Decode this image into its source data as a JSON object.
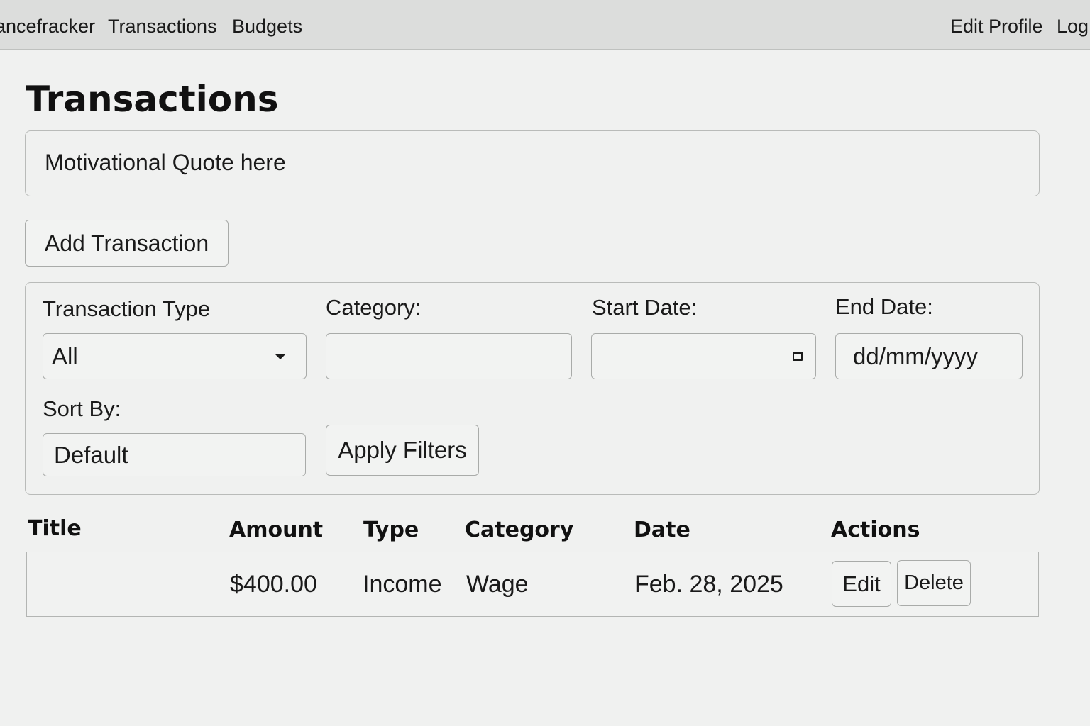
{
  "navbar": {
    "brand": "ancefracker",
    "transactions": "Transactions",
    "budgets": "Budgets",
    "edit_profile": "Edit Profile",
    "logout": "Log"
  },
  "page": {
    "title": "Transactions",
    "quote": "Motivational Quote here",
    "add_button": "Add Transaction"
  },
  "filters": {
    "type_label": "Transaction Type",
    "type_value": "All",
    "category_label": "Category:",
    "category_value": "",
    "start_label": "Start Date:",
    "end_label": "End Date:",
    "end_placeholder": "dd/mm/yyyy",
    "sort_label": "Sort By:",
    "sort_value": "Default",
    "apply_button": "Apply Filters"
  },
  "table": {
    "headers": [
      "Title",
      "Amount",
      "Type",
      "Category",
      "Date",
      "Actions"
    ],
    "rows": [
      {
        "title": "",
        "amount": "$400.00",
        "type": "Income",
        "category": "Wage",
        "date": "Feb. 28, 2025",
        "edit_label": "Edit",
        "delete_label": "Delete"
      }
    ]
  },
  "icons": {
    "type_select": "chevron-down-icon",
    "start_date": "calendar-icon"
  }
}
